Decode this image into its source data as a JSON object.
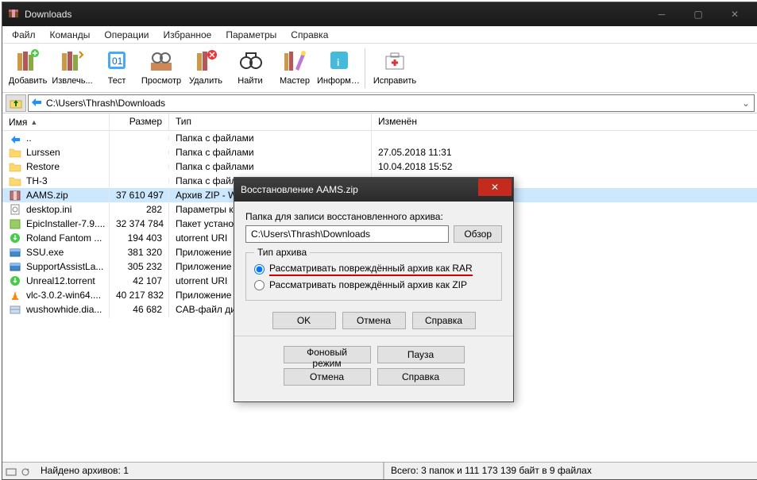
{
  "window": {
    "title": "Downloads"
  },
  "menu": [
    "Файл",
    "Команды",
    "Операции",
    "Избранное",
    "Параметры",
    "Справка"
  ],
  "toolbar": [
    {
      "name": "add",
      "label": "Добавить"
    },
    {
      "name": "extract",
      "label": "Извлечь..."
    },
    {
      "name": "test",
      "label": "Тест"
    },
    {
      "name": "view",
      "label": "Просмотр"
    },
    {
      "name": "delete",
      "label": "Удалить"
    },
    {
      "name": "find",
      "label": "Найти"
    },
    {
      "name": "wizard",
      "label": "Мастер"
    },
    {
      "name": "info",
      "label": "Информация"
    },
    {
      "name": "repair",
      "label": "Исправить"
    }
  ],
  "path": "C:\\Users\\Thrash\\Downloads",
  "columns": {
    "name": "Имя",
    "size": "Размер",
    "type": "Тип",
    "modified": "Изменён"
  },
  "rows": [
    {
      "icon": "up",
      "name": "..",
      "size": "",
      "type": "Папка с файлами",
      "date": ""
    },
    {
      "icon": "folder",
      "name": "Lurssen",
      "size": "",
      "type": "Папка с файлами",
      "date": "27.05.2018 11:31"
    },
    {
      "icon": "folder",
      "name": "Restore",
      "size": "",
      "type": "Папка с файлами",
      "date": "10.04.2018 15:52"
    },
    {
      "icon": "folder",
      "name": "TH-3",
      "size": "",
      "type": "Папка с файлами",
      "date": ""
    },
    {
      "icon": "zip",
      "name": "AAMS.zip",
      "size": "37 610 497",
      "type": "Архив ZIP - WinRAR",
      "date": "",
      "selected": true
    },
    {
      "icon": "ini",
      "name": "desktop.ini",
      "size": "282",
      "type": "Параметры конфигурации",
      "date": ""
    },
    {
      "icon": "exe",
      "name": "EpicInstaller-7.9....",
      "size": "32 374 784",
      "type": "Пакет установщика Windows",
      "date": ""
    },
    {
      "icon": "torrent",
      "name": "Roland Fantom ...",
      "size": "194 403",
      "type": "utorrent URI",
      "date": ""
    },
    {
      "icon": "exe2",
      "name": "SSU.exe",
      "size": "381 320",
      "type": "Приложение",
      "date": ""
    },
    {
      "icon": "exe2",
      "name": "SupportAssistLa...",
      "size": "305 232",
      "type": "Приложение",
      "date": ""
    },
    {
      "icon": "torrent",
      "name": "Unreal12.torrent",
      "size": "42 107",
      "type": "utorrent URI",
      "date": ""
    },
    {
      "icon": "vlc",
      "name": "vlc-3.0.2-win64....",
      "size": "40 217 832",
      "type": "Приложение",
      "date": ""
    },
    {
      "icon": "cab",
      "name": "wushowhide.dia...",
      "size": "46 682",
      "type": "CAB-файл диагностики",
      "date": ""
    }
  ],
  "status": {
    "left": "Найдено архивов: 1",
    "right": "Всего: 3 папок и 111 173 139 байт в 9 файлах"
  },
  "dialog": {
    "title": "Восстановление AAMS.zip",
    "folder_label": "Папка для записи восстановленного архива:",
    "folder_value": "C:\\Users\\Thrash\\Downloads",
    "browse": "Обзор",
    "group": "Тип архива",
    "radio_rar": "Рассматривать повреждённый архив как RAR",
    "radio_zip": "Рассматривать повреждённый архив как ZIP",
    "ok": "OK",
    "cancel": "Отмена",
    "help": "Справка",
    "bg": "Фоновый режим",
    "pause": "Пауза"
  }
}
